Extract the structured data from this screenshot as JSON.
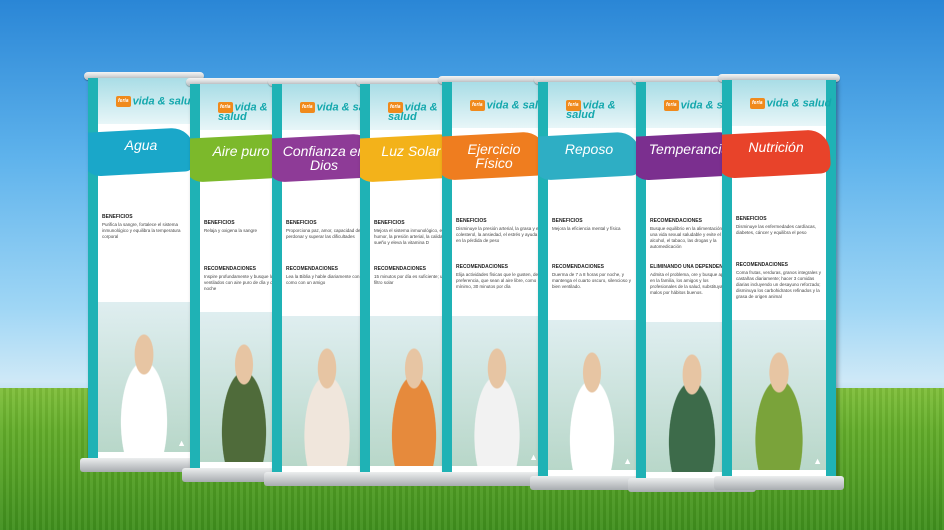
{
  "scene": {
    "sky_color": "#5fb3ec",
    "grass_color": "#63ad2a",
    "accent": "#1fb2b5"
  },
  "banners": [
    {
      "title": "Agua",
      "brand_tag": "feria",
      "brand": "vida & salud",
      "color": "#1aa7c9",
      "shirt": "#ffffff",
      "sections": [
        {
          "heading": "BENEFICIOS",
          "text": "Purifica la sangre, fortalece el sistema inmunológico y equilibra la temperatura corporal"
        }
      ]
    },
    {
      "title": "Aire puro",
      "brand_tag": "feria",
      "brand": "vida & salud",
      "color": "#7cb92b",
      "shirt": "#4f6b3a",
      "sections": [
        {
          "heading": "BENEFICIOS",
          "text": "Relaja y oxigena la sangre"
        },
        {
          "heading": "RECOMENDACIONES",
          "text": "Inspire profundamente y busque lugares ventilados con aire puro de día y de noche"
        }
      ]
    },
    {
      "title": "Confianza en Dios",
      "brand_tag": "feria",
      "brand": "vida & salud",
      "color": "#8e3b97",
      "shirt": "#f0e6dc",
      "sections": [
        {
          "heading": "BENEFICIOS",
          "text": "Proporciona paz, amor, capacidad de perdonar y superar las dificultades"
        },
        {
          "heading": "RECOMENDACIONES",
          "text": "Lea la Biblia y hable diariamente con Dios como con un amigo"
        }
      ]
    },
    {
      "title": "Luz Solar",
      "brand_tag": "feria",
      "brand": "vida & salud",
      "color": "#f3b21a",
      "shirt": "#e68a3c",
      "sections": [
        {
          "heading": "BENEFICIOS",
          "text": "Mejora el sistema inmunológico, el humor, la presión arterial, la calidad del sueño y eleva la vitamina D"
        },
        {
          "heading": "RECOMENDACIONES",
          "text": "15 minutos por día es suficiente; use filtro solar"
        }
      ]
    },
    {
      "title": "Ejercicio Físico",
      "brand_tag": "feria",
      "brand": "vida & salud",
      "color": "#ef7d1f",
      "shirt": "#f2f2f2",
      "sections": [
        {
          "heading": "BENEFICIOS",
          "text": "Disminuye la presión arterial, la grasa y el colesterol, la ansiedad, el estrés y ayuda en la pérdida de peso"
        },
        {
          "heading": "RECOMENDACIONES",
          "text": "Elija actividades físicas que le gusten, de preferencia, que sean al aire libre, como mínimo, 30 minutos por día"
        }
      ]
    },
    {
      "title": "Reposo",
      "brand_tag": "feria",
      "brand": "vida & salud",
      "color": "#2eaec4",
      "shirt": "#ffffff",
      "sections": [
        {
          "heading": "BENEFICIOS",
          "text": "Mejora la eficiencia mental y física"
        },
        {
          "heading": "RECOMENDACIONES",
          "text": "Duerma de 7 a 8 horas por noche, y mantenga el cuarto oscuro, silencioso y bien ventilado."
        }
      ]
    },
    {
      "title": "Temperancia",
      "brand_tag": "feria",
      "brand": "vida & salud",
      "color": "#7b2f8f",
      "shirt": "#3d6b4a",
      "sections": [
        {
          "heading": "RECOMENDACIONES",
          "text": "Busque equilibrio en la alimentación, en una vida sexual saludable y evite el alcohol, el tabaco, las drogas y la automedicación"
        },
        {
          "heading": "ELIMINANDO UNA DEPENDENCIA",
          "text": "Admita el problema, ore y busque apoyo en la familia, los amigos y los profesionales de la salud, substituya los malos por hábitos buenos."
        }
      ]
    },
    {
      "title": "Nutrición",
      "brand_tag": "feria",
      "brand": "vida & salud",
      "color": "#e8432a",
      "shirt": "#7aa33a",
      "sections": [
        {
          "heading": "BENEFICIOS",
          "text": "Disminuye las enfermedades cardíacas, diabetes, cáncer y equilibra el peso"
        },
        {
          "heading": "RECOMENDACIONES",
          "text": "Coma frutas, verduras, granos integrales y castañas diariamente; hacer 3 comidas diarias incluyendo un desayuno reforzado; disminuya los carbohidratos refinados y la grasa de origen animal"
        }
      ]
    }
  ]
}
